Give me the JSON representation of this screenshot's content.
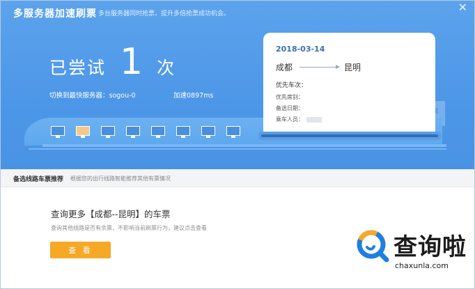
{
  "header": {
    "title": "多服务器加速刷票",
    "subtitle": "多台服务器同时抢票，提升多倍抢票成功机会。",
    "close_icon": "close-icon"
  },
  "status": {
    "tried_prefix": "已尝试",
    "tried_count": "1",
    "tried_suffix": "次",
    "server_label": "切换到最快服务器：sogou-0",
    "speed_label": "加速0897ms"
  },
  "train_windows": {
    "count": 8,
    "active_index": 1
  },
  "ticket": {
    "date": "2018-03-14",
    "from": "成都",
    "to": "昆明",
    "preferred_train": "优先车次：",
    "preferred_seat": "优先席别：",
    "alt_date": "备选日期：",
    "passengers": "乘车人员："
  },
  "recommend": {
    "title": "备选线路车票推荐",
    "desc": "根据您的出行线路智能推荐其他有票情况",
    "query_title": "查询更多【成都--昆明】的车票",
    "query_desc": "查询其他线路是否有余票，不影响当前刷票行为，建议点击查看",
    "button_label": "查 看"
  },
  "watermark": {
    "name": "查询啦",
    "url": "chaxunla.com"
  },
  "colors": {
    "banner": "#4d97e8",
    "button": "#f6a827",
    "ticket_date": "#3b6fb3"
  }
}
